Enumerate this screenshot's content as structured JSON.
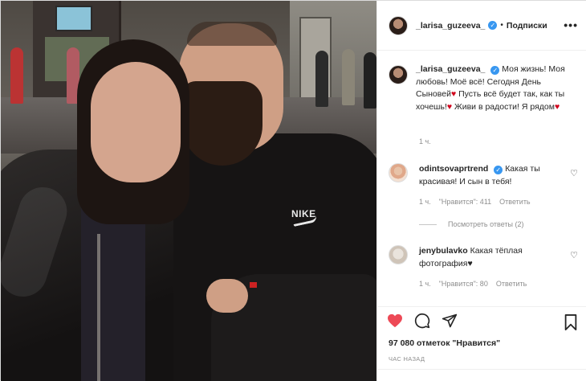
{
  "post": {
    "username": "_larisa_guzeeva_",
    "separator": "•",
    "follow_label": "Подписки",
    "more_label": "•••"
  },
  "caption": {
    "username": "_larisa_guzeeva_",
    "text_part1": "Моя жизнь! Моя любовь! Моё всё! Сегодня День Сыновей",
    "text_part2": "Пусть всё будет так, как ты хочешь!",
    "text_part3": "Живи в радости! Я рядом",
    "heart": "♥",
    "time": "1 ч."
  },
  "comments": [
    {
      "username": "odintsovaprtrend",
      "verified": true,
      "text": "Какая ты красивая! И сын в тебя!",
      "time": "1 ч.",
      "likes": "\"Нравится\": 411",
      "reply": "Ответить",
      "view_replies": "Посмотреть ответы (2)"
    },
    {
      "username": "jenybulavko",
      "verified": false,
      "text": "Какая тёплая фотография",
      "heart": "♥",
      "time": "1 ч.",
      "likes": "\"Нравится\": 80",
      "reply": "Ответить"
    }
  ],
  "stats": {
    "likes": "97 080 отметок \"Нравится\"",
    "timestamp": "ЧАС НАЗАД"
  },
  "photo": {
    "shirt_brand": "NIKE"
  },
  "colors": {
    "like_red": "#ed4956",
    "verified_blue": "#3897f0",
    "muted": "#8e8e8e"
  },
  "icons": [
    "heart-filled-icon",
    "comment-icon",
    "share-icon",
    "bookmark-icon"
  ]
}
